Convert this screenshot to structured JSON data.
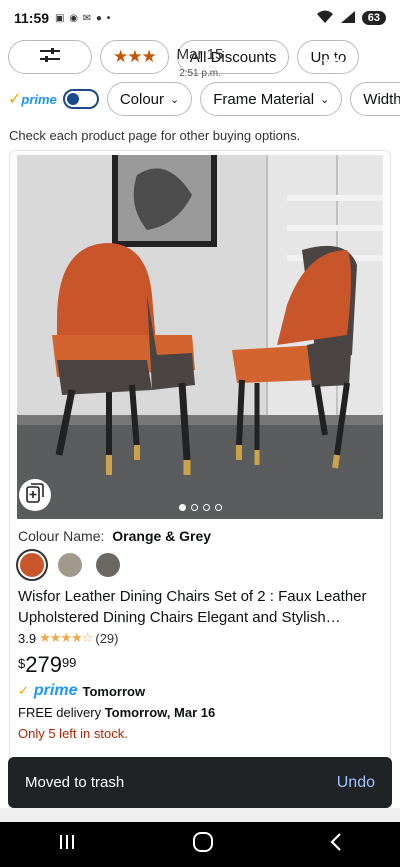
{
  "status_bar": {
    "time": "11:59",
    "battery": "63"
  },
  "photo_overlay": {
    "date": "Mar 15",
    "time": "2:51 p.m."
  },
  "filters": {
    "row1": {
      "rating_stars": "★★★",
      "all_discounts": "All Discounts",
      "up_to": "Up to"
    },
    "row2": {
      "prime_label": "prime",
      "colour": "Colour",
      "frame_material": "Frame Material",
      "width": "Width"
    }
  },
  "check_note": "Check each product page for other buying options.",
  "product": {
    "colour_label": "Colour Name:",
    "colour_value": "Orange & Grey",
    "swatches": [
      "#c8562a",
      "#a19a8c",
      "#6b6762"
    ],
    "title": "Wisfor Leather Dining Chairs Set of 2 : Faux Leather Upholstered Dining Chairs Elegant and Stylish…",
    "rating": "3.9",
    "rating_stars": "★★★★☆",
    "review_count": "(29)",
    "price_currency": "$",
    "price_whole": "279",
    "price_fraction": "99",
    "prime_label": "prime",
    "prime_when": "Tomorrow",
    "delivery_prefix": "FREE delivery",
    "delivery_date": "Tomorrow, Mar 16",
    "stock": "Only 5 left in stock."
  },
  "toast": {
    "message": "Moved to trash",
    "action": "Undo"
  },
  "colors": {
    "accent_orange": "#c45500",
    "prime_blue": "#1a98ff",
    "stock_red": "#b12704",
    "toast_bg": "#1f2326"
  }
}
